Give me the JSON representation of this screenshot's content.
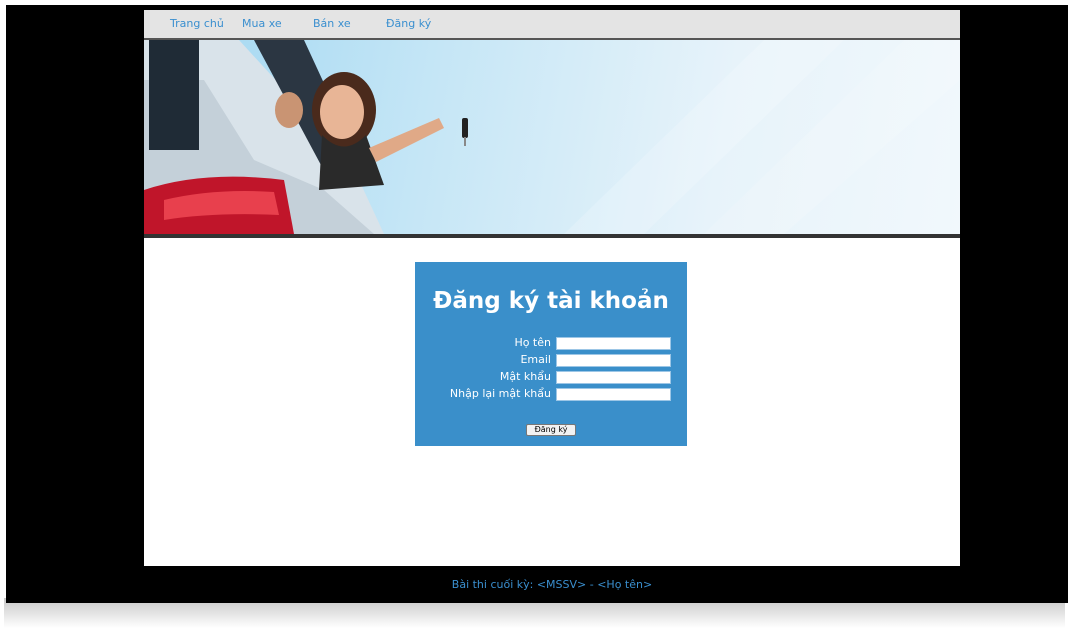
{
  "nav": {
    "items": [
      "Trang chủ",
      "Mua xe",
      "Bán xe",
      "Đăng ký"
    ]
  },
  "form": {
    "title": "Đăng ký tài khoản",
    "fields": [
      {
        "label": "Họ tên",
        "value": ""
      },
      {
        "label": "Email",
        "value": ""
      },
      {
        "label": "Mật khẩu",
        "value": ""
      },
      {
        "label": "Nhập lại mật khẩu",
        "value": ""
      }
    ],
    "submit_label": "Đăng ký"
  },
  "footer": {
    "text": "Bài thi cuối kỳ: <MSSV> - <Họ tên>"
  },
  "colors": {
    "accent": "#3a8fca",
    "nav_background": "#e4e4e4",
    "outer_background": "#000000"
  }
}
